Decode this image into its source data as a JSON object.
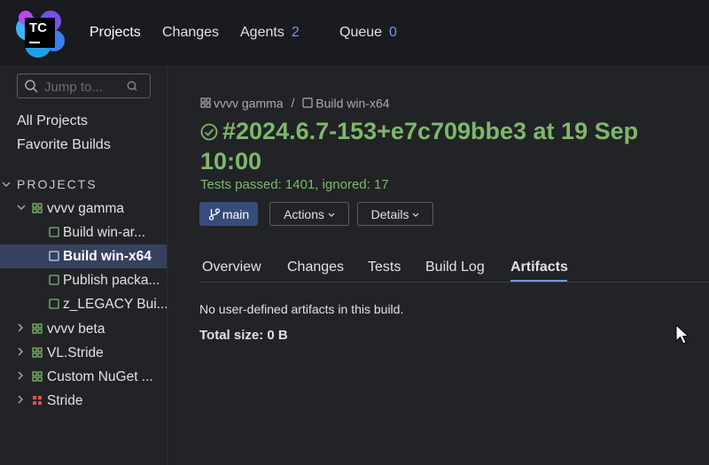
{
  "app": {
    "logo_text": "TC",
    "colors": {
      "accent": "#6f99ea",
      "success": "#7eb86a",
      "selected": "#364160",
      "branch": "#364c7a",
      "failed": "#d9534f"
    }
  },
  "nav": {
    "projects": "Projects",
    "changes": "Changes",
    "agents": "Agents",
    "agents_count": "2",
    "queue": "Queue",
    "queue_count": "0"
  },
  "sidebar": {
    "search_placeholder": "Jump to...",
    "all_projects": "All Projects",
    "favorite_builds": "Favorite Builds",
    "section_title": "PROJECTS",
    "tree": [
      {
        "label": "vvvv gamma",
        "icon": "project-icon",
        "expanded": true
      },
      {
        "label": "Build win-ar...",
        "icon": "build-config-icon"
      },
      {
        "label": "Build win-x64",
        "icon": "build-config-icon",
        "selected": true
      },
      {
        "label": "Publish packa...",
        "icon": "build-config-icon"
      },
      {
        "label": "z_LEGACY Bui...",
        "icon": "build-config-icon"
      },
      {
        "label": "vvvv beta",
        "icon": "project-icon",
        "expanded": false
      },
      {
        "label": "VL.Stride",
        "icon": "project-icon",
        "expanded": false
      },
      {
        "label": "Custom NuGet ...",
        "icon": "project-icon",
        "expanded": false
      },
      {
        "label": "Stride",
        "icon": "project-failed-icon",
        "expanded": false
      }
    ]
  },
  "main": {
    "breadcrumb": {
      "project": "vvvv gamma",
      "separator": "/",
      "build_config": "Build win-x64"
    },
    "title_line1": "#2024.6.7-153+e7c709bbe3 at 19 Sep",
    "title_line2": "10:00",
    "status": "Tests passed: 1401, ignored: 17",
    "branch_label": "main",
    "actions_label": "Actions",
    "details_label": "Details",
    "tabs": [
      "Overview",
      "Changes",
      "Tests",
      "Build Log",
      "Artifacts"
    ],
    "active_tab": "Artifacts",
    "artifacts_message": "No user-defined artifacts in this build.",
    "total_size": "Total size: 0 B"
  }
}
